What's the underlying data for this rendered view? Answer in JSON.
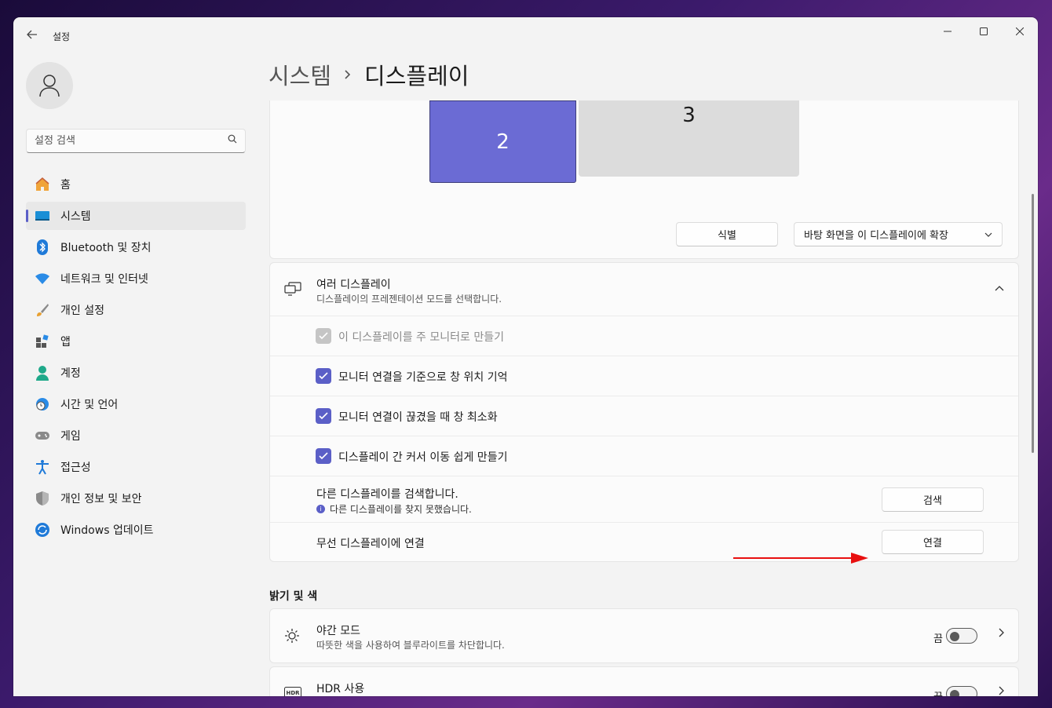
{
  "window": {
    "title": "설정"
  },
  "sidebar": {
    "search_placeholder": "설정 검색",
    "items": [
      {
        "label": "홈"
      },
      {
        "label": "시스템"
      },
      {
        "label": "Bluetooth 및 장치"
      },
      {
        "label": "네트워크 및 인터넷"
      },
      {
        "label": "개인 설정"
      },
      {
        "label": "앱"
      },
      {
        "label": "계정"
      },
      {
        "label": "시간 및 언어"
      },
      {
        "label": "게임"
      },
      {
        "label": "접근성"
      },
      {
        "label": "개인 정보 및 보안"
      },
      {
        "label": "Windows 업데이트"
      }
    ]
  },
  "breadcrumb": {
    "parent": "시스템",
    "current": "디스플레이"
  },
  "arrange": {
    "monitor_2": "2",
    "monitor_3": "3",
    "identify_label": "식별",
    "mode_value": "바탕 화면을 이 디스플레이에 확장"
  },
  "multi": {
    "title": "여러 디스플레이",
    "subtitle": "디스플레이의 프레젠테이션 모드를 선택합니다.",
    "options": [
      {
        "label": "이 디스플레이를 주 모니터로 만들기",
        "checked": true,
        "disabled": true
      },
      {
        "label": "모니터 연결을 기준으로 창 위치 기억",
        "checked": true,
        "disabled": false
      },
      {
        "label": "모니터 연결이 끊겼을 때 창 최소화",
        "checked": true,
        "disabled": false
      },
      {
        "label": "디스플레이 간 커서 이동 쉽게 만들기",
        "checked": true,
        "disabled": false
      }
    ],
    "detect_title": "다른 디스플레이를 검색합니다.",
    "detect_status": "다른 디스플레이를 찾지 못했습니다.",
    "detect_button": "검색",
    "wireless_label": "무선 디스플레이에 연결",
    "connect_button": "연결"
  },
  "brightness": {
    "section_title": "밝기 및 색",
    "night_title": "야간 모드",
    "night_sub": "따뜻한 색을 사용하여 블루라이트를 차단합니다.",
    "night_state": "끔",
    "hdr_title": "HDR 사용",
    "hdr_state": "끔"
  },
  "colors": {
    "accent": "#5b5fc7",
    "monitor_selected": "#6b6bd4",
    "arrow": "#e81010"
  }
}
